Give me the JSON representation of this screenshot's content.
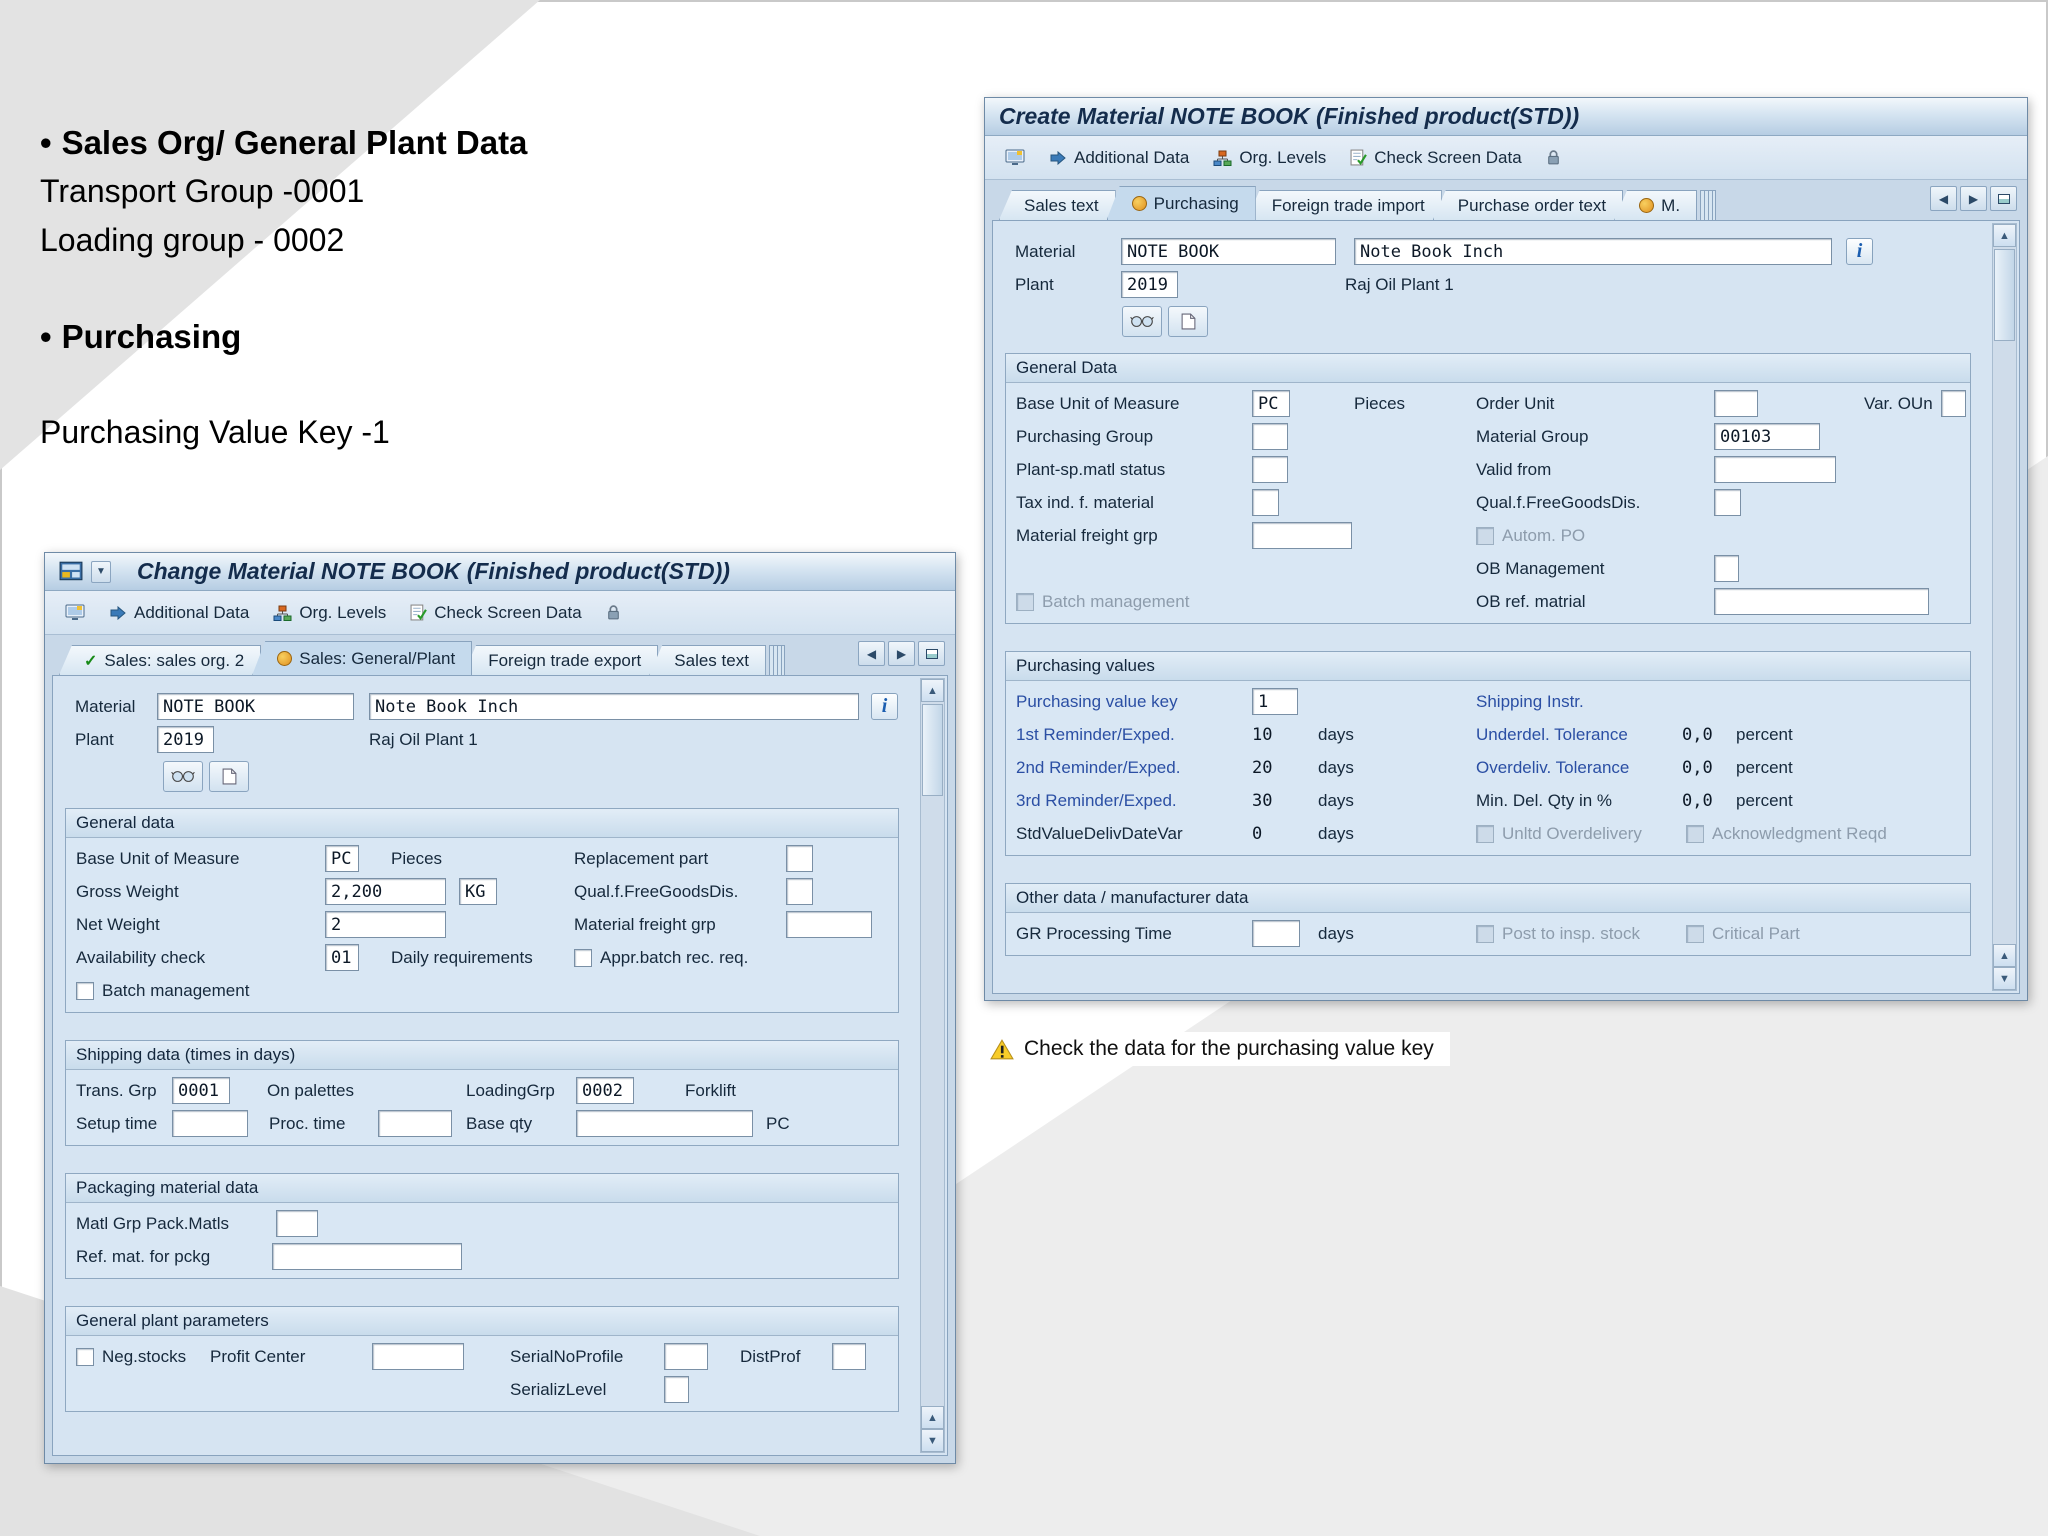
{
  "colors": {
    "link_blue": "#2b4fa4",
    "warning_yellow": "#f8cc28",
    "titlebar_blue": "#b6cde3"
  },
  "icons": {
    "up": "▲",
    "down": "▼",
    "left": "◀",
    "right": "▶",
    "info": "i",
    "warning": "!",
    "check": "✓",
    "dropdown": "▼"
  },
  "slide": {
    "bullet": "•",
    "b1_title": "Sales Org/ General Plant Data",
    "b1_line1": "Transport Group -0001",
    "b1_line2": "Loading group - 0002",
    "b2_title": "Purchasing",
    "b2_line1": "Purchasing Value Key -1",
    "status_message": "Check the data for the purchasing value key"
  },
  "common": {
    "toolbar": {
      "additional_data": "Additional Data",
      "org_levels": "Org. Levels",
      "check_screen_data": "Check Screen Data"
    }
  },
  "cw": {
    "title": "Create Material NOTE BOOK (Finished product(STD))",
    "tabs": [
      "Sales text",
      "Purchasing",
      "Foreign trade import",
      "Purchase order text",
      "M."
    ],
    "header": {
      "material_label": "Material",
      "material_value": "NOTE BOOK",
      "material_desc": "Note Book Inch",
      "plant_label": "Plant",
      "plant_value": "2019",
      "plant_desc": "Raj Oil Plant 1"
    },
    "general": {
      "title": "General Data",
      "base_unit": "Base Unit of Measure",
      "base_unit_value": "PC",
      "pieces": "Pieces",
      "order_unit": "Order Unit",
      "var_oun": "Var. OUn",
      "purchasing_group": "Purchasing Group",
      "material_group": "Material Group",
      "material_group_value": "00103",
      "plant_status": "Plant-sp.matl status",
      "valid_from": "Valid from",
      "tax_ind": "Tax ind. f. material",
      "qual_free": "Qual.f.FreeGoodsDis.",
      "freight_grp": "Material freight grp",
      "autom_po": "Autom. PO",
      "ob_mgmt": "OB Management",
      "batch_mgmt": "Batch management",
      "ob_ref": "OB ref. matrial"
    },
    "pval": {
      "title": "Purchasing values",
      "pvk": "Purchasing value key",
      "pvk_value": "1",
      "shipping_instr": "Shipping Instr.",
      "r1": "1st Reminder/Exped.",
      "r1_value": "10",
      "r2": "2nd Reminder/Exped.",
      "r2_value": "20",
      "r3": "3rd Reminder/Exped.",
      "r3_value": "30",
      "days": "days",
      "underdel": "Underdel. Tolerance",
      "underdel_value": "0,0",
      "overdel": "Overdeliv. Tolerance",
      "overdel_value": "0,0",
      "mindel": "Min. Del. Qty in %",
      "mindel_value": "0,0",
      "percent": "percent",
      "std": "StdValueDelivDateVar",
      "std_value": "0",
      "unltd": "Unltd Overdelivery",
      "ack": "Acknowledgment Reqd"
    },
    "other": {
      "title": "Other data / manufacturer data",
      "gr_time": "GR Processing Time",
      "days": "days",
      "post_insp": "Post to insp. stock",
      "critical": "Critical Part"
    }
  },
  "chw": {
    "title": "Change Material NOTE BOOK (Finished product(STD))",
    "tabs": [
      "Sales: sales org. 2",
      "Sales: General/Plant",
      "Foreign trade export",
      "Sales text"
    ],
    "header": {
      "material_label": "Material",
      "material_value": "NOTE BOOK",
      "material_desc": "Note Book Inch",
      "plant_label": "Plant",
      "plant_value": "2019",
      "plant_desc": "Raj Oil Plant 1"
    },
    "general": {
      "title": "General data",
      "base_unit": "Base Unit of Measure",
      "base_unit_value": "PC",
      "pieces": "Pieces",
      "replacement": "Replacement part",
      "gross_weight": "Gross Weight",
      "gross_weight_value": "2,200",
      "weight_unit_value": "KG",
      "qual_free": "Qual.f.FreeGoodsDis.",
      "net_weight": "Net Weight",
      "net_weight_value": "2",
      "freight_grp": "Material freight grp",
      "avail_check": "Availability check",
      "avail_check_value": "01",
      "daily_req": "Daily requirements",
      "appr_batch": "Appr.batch rec. req.",
      "batch_mgmt": "Batch management"
    },
    "shipping": {
      "title": "Shipping data (times in days)",
      "trans_grp": "Trans. Grp",
      "trans_grp_value": "0001",
      "on_palettes": "On palettes",
      "loading_grp": "LoadingGrp",
      "loading_grp_value": "0002",
      "forklift": "Forklift",
      "setup_time": "Setup time",
      "proc_time": "Proc. time",
      "base_qty": "Base qty",
      "base_qty_unit": "PC"
    },
    "packaging": {
      "title": "Packaging material data",
      "matl_grp": "Matl Grp Pack.Matls",
      "ref_mat": "Ref. mat. for pckg"
    },
    "plant_params": {
      "title": "General plant parameters",
      "neg_stocks": "Neg.stocks",
      "profit_center": "Profit Center",
      "serial_profile": "SerialNoProfile",
      "dist_prof": "DistProf",
      "serializ_level": "SerializLevel"
    }
  }
}
